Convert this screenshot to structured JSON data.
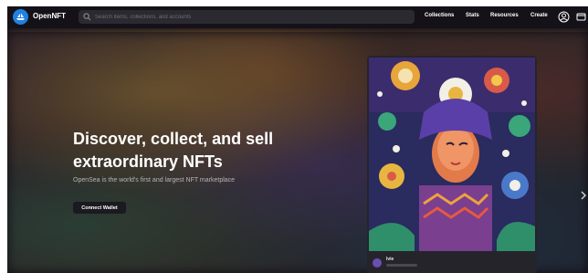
{
  "nav": {
    "brand": "OpenNFT",
    "search_placeholder": "Search items, collections, and accounts",
    "links": [
      "Collections",
      "Stats",
      "Resources",
      "Create"
    ],
    "icons": [
      "account-icon",
      "wallet-icon"
    ]
  },
  "hero": {
    "title_line1": "Discover, collect, and sell",
    "title_line2": "extraordinary NFTs",
    "subtitle": "OpenSea is the world's first and largest NFT marketplace",
    "cta_label": "Connect Wallet"
  },
  "featured": {
    "creator_name": "Ivie"
  },
  "colors": {
    "nav_bg": "#141218",
    "logo_blue": "#2081e2",
    "card_bg": "#26242b"
  }
}
